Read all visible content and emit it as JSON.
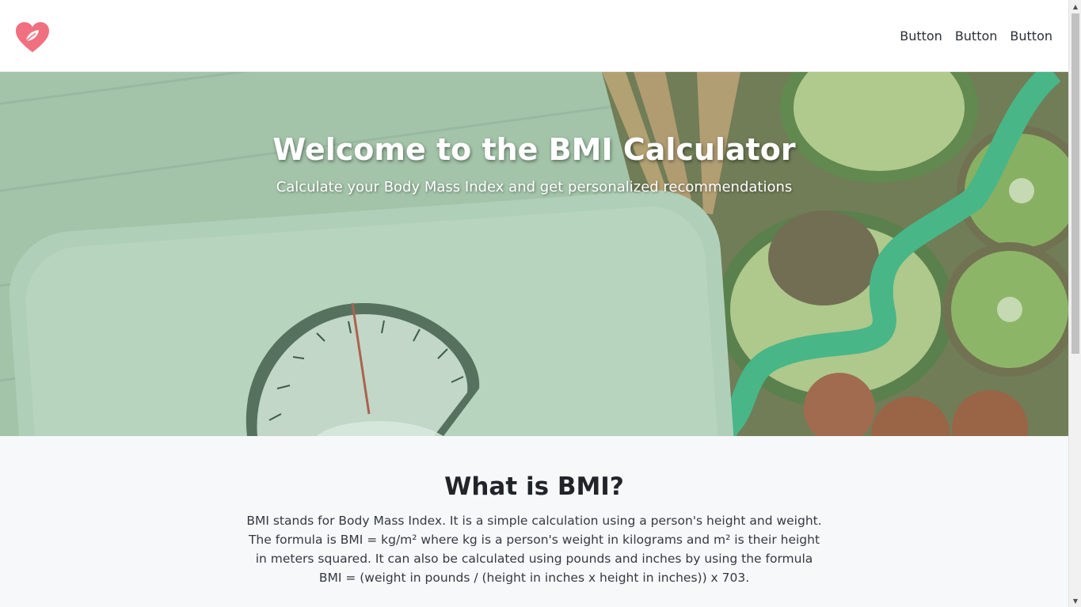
{
  "header": {
    "logo_icon": "heart-leaf-icon",
    "nav": [
      {
        "label": "Button"
      },
      {
        "label": "Button"
      },
      {
        "label": "Button"
      }
    ]
  },
  "hero": {
    "title": "Welcome to the BMI Calculator",
    "subtitle": "Calculate your Body Mass Index and get personalized recommendations"
  },
  "bmi_section": {
    "title": "What is BMI?",
    "text": "BMI stands for Body Mass Index. It is a simple calculation using a person's height and weight. The formula is BMI = kg/m² where kg is a person's weight in kilograms and m² is their height in meters squared. It can also be calculated using pounds and inches by using the formula BMI = (weight in pounds / (height in inches x height in inches)) x 703."
  },
  "colors": {
    "brand": "#f0707f",
    "hero_tint": "#a9c4ad"
  }
}
